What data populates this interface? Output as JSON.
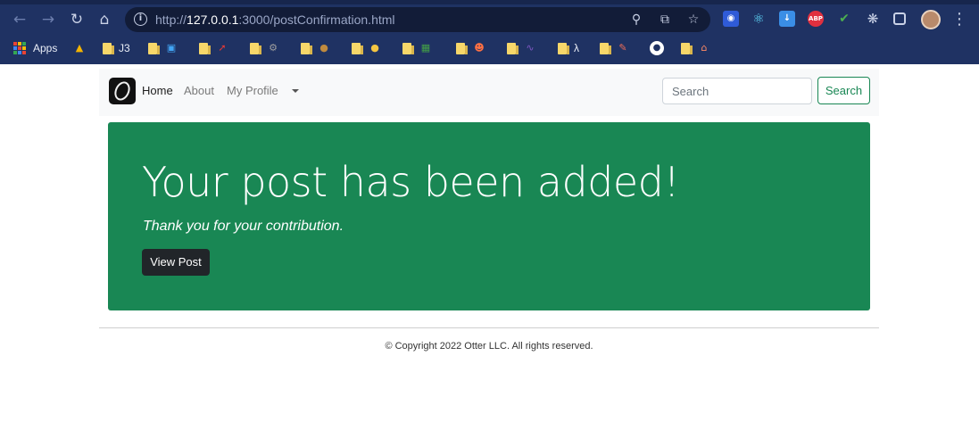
{
  "browser": {
    "url_prefix": "http://",
    "url_host": "127.0.0.1",
    "url_rest": ":3000/postConfirmation.html",
    "icons": [
      "back-icon",
      "forward-icon",
      "reload-icon",
      "home-icon",
      "info-icon",
      "zoom-icon",
      "share-icon",
      "star-icon",
      "puzzle-icon",
      "sidepanel-icon",
      "menu-icon"
    ],
    "extensions": [
      {
        "name": "bitwarden-extension-icon",
        "color": "#2f5bd8"
      },
      {
        "name": "react-devtools-extension-icon",
        "color": "#61dafb"
      },
      {
        "name": "download-extension-icon",
        "color": "#3a8ee6"
      },
      {
        "name": "adblock-extension-icon",
        "label": "ABP",
        "color": "#e0303f"
      },
      {
        "name": "colorpicker-extension-icon",
        "color": "#4caf50"
      }
    ]
  },
  "bookmarks": {
    "apps_label": "Apps",
    "items": [
      {
        "name": "bookmark-drive",
        "icon": "drive-icon"
      },
      {
        "name": "bookmark-j3",
        "label": "J3"
      },
      {
        "name": "bookmark-monitor",
        "icon": "monitor-icon"
      },
      {
        "name": "bookmark-arrow",
        "icon": "arrow-icon"
      },
      {
        "name": "bookmark-settings",
        "icon": "gear-icon"
      },
      {
        "name": "bookmark-money",
        "icon": "moneybag-icon"
      },
      {
        "name": "bookmark-muscle",
        "icon": "muscle-icon"
      },
      {
        "name": "bookmark-books",
        "icon": "books-icon"
      },
      {
        "name": "bookmark-face",
        "icon": "face-icon"
      },
      {
        "name": "bookmark-chart",
        "icon": "chart-icon"
      },
      {
        "name": "bookmark-lambda",
        "label": "λ"
      },
      {
        "name": "bookmark-pencil",
        "icon": "pencil-icon"
      },
      {
        "name": "bookmark-github",
        "icon": "github-icon"
      },
      {
        "name": "bookmark-home",
        "icon": "house-icon"
      }
    ]
  },
  "navbar": {
    "links": [
      "Home",
      "About",
      "My Profile"
    ],
    "search_placeholder": "Search",
    "search_button": "Search"
  },
  "hero": {
    "heading": "Your post has been added!",
    "lead": "Thank you for your contribution.",
    "button": "View Post"
  },
  "footer": {
    "text": "© Copyright 2022 Otter LLC. All rights reserved."
  },
  "colors": {
    "chrome": "#1f3263",
    "success": "#198754",
    "dark_button": "#212529",
    "navbar_bg": "#f8f9fa"
  }
}
